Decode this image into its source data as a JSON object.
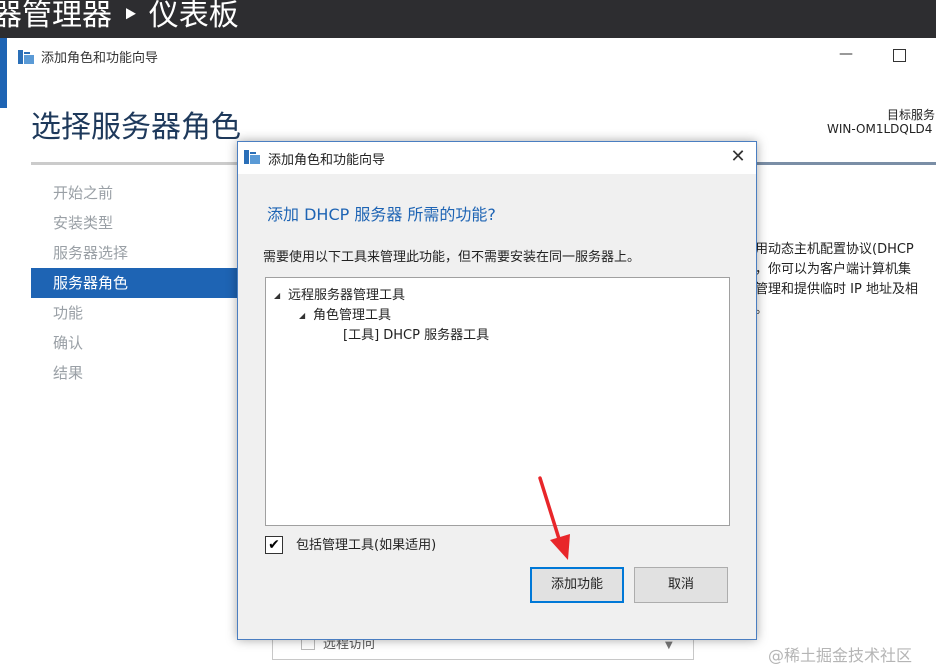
{
  "server_manager": {
    "title": "器管理器 ‣ 仪表板"
  },
  "wizard": {
    "window_title": "添加角色和功能向导",
    "page_heading": "选择服务器角色",
    "target_label": "目标服务",
    "target_server": "WIN-OM1LDQLD4",
    "steps": [
      {
        "label": "开始之前"
      },
      {
        "label": "安装类型"
      },
      {
        "label": "服务器选择"
      },
      {
        "label": "服务器角色"
      },
      {
        "label": "功能"
      },
      {
        "label": "确认"
      },
      {
        "label": "结果"
      }
    ],
    "active_step": 3,
    "description_lines": [
      "用动态主机配置协议(DHCP",
      "，你可以为客户端计算机集",
      "管理和提供临时 IP 地址及相",
      "。"
    ],
    "bottom_list_item": "远程访问"
  },
  "dialog": {
    "title": "添加角色和功能向导",
    "heading": "添加 DHCP 服务器 所需的功能?",
    "description": "需要使用以下工具来管理此功能，但不需要安装在同一服务器上。",
    "tree": [
      {
        "label": "远程服务器管理工具",
        "expanded": true
      },
      {
        "label": "角色管理工具",
        "expanded": true
      },
      {
        "label": "[工具] DHCP 服务器工具"
      }
    ],
    "include_tools_label": "包括管理工具(如果适用)",
    "include_tools_checked": true,
    "add_button": "添加功能",
    "cancel_button": "取消"
  },
  "watermark": "@稀土掘金技术社区",
  "colors": {
    "accent": "#1e64b4",
    "titlebar": "#2d2d30",
    "arrow": "#e8262a"
  }
}
